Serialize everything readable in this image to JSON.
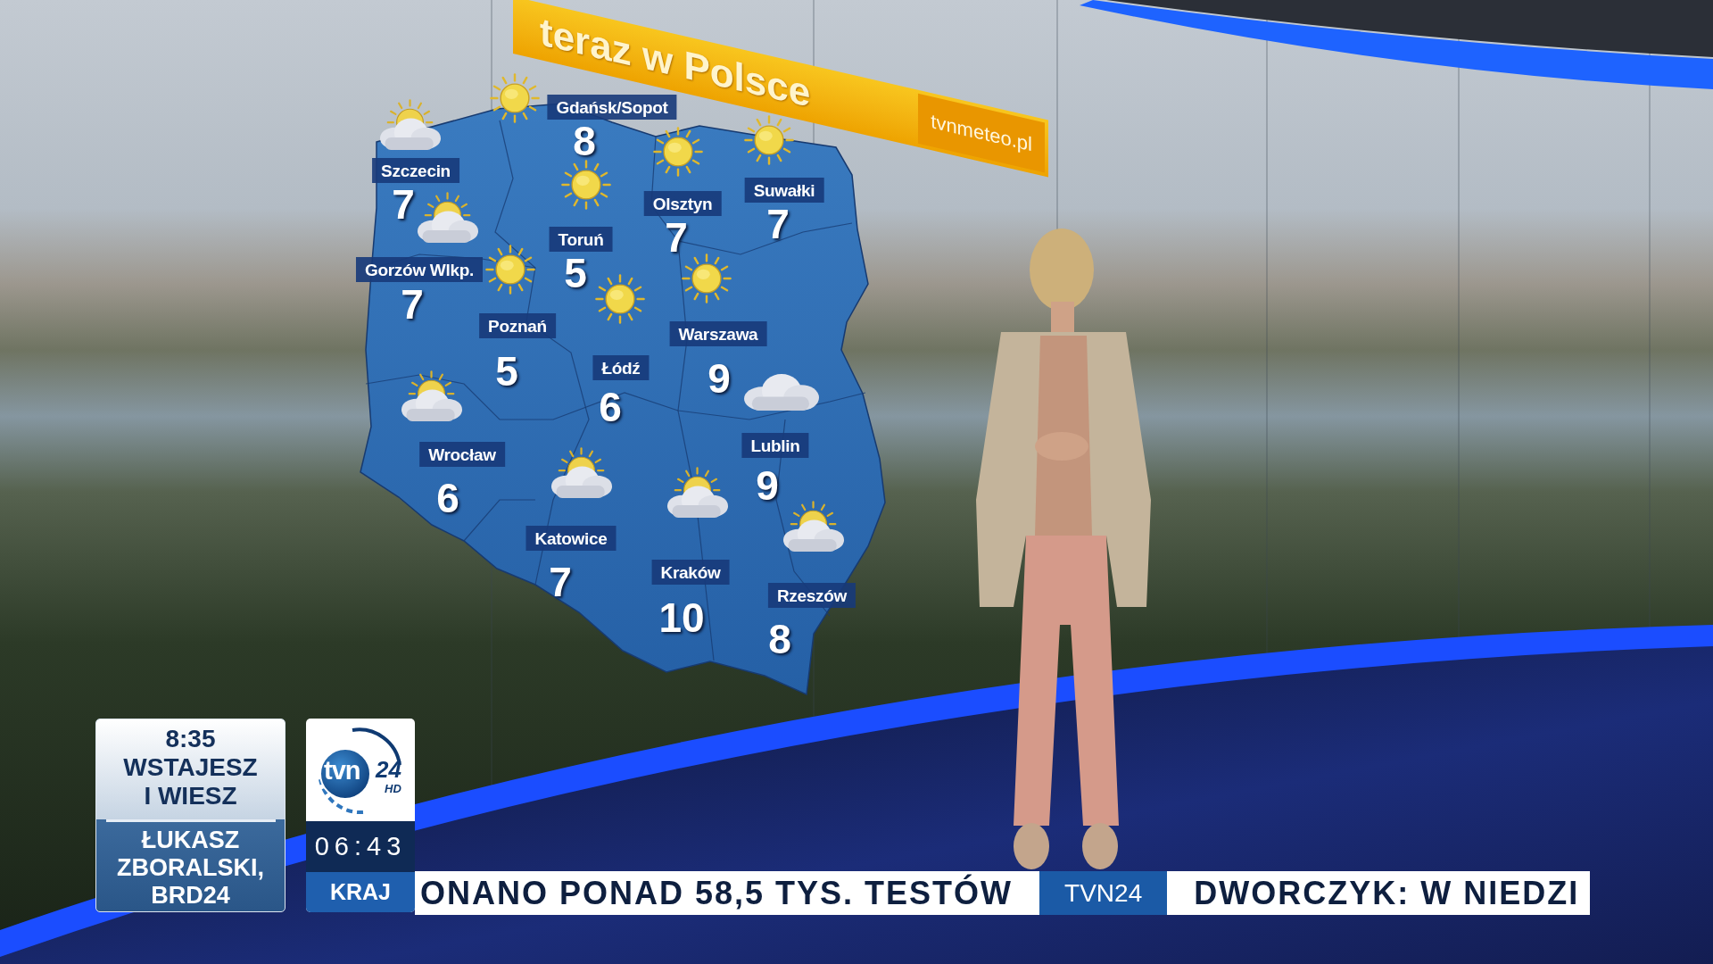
{
  "banner": {
    "title": "teraz w Polsce",
    "website": "tvnmeteo.pl"
  },
  "cities": [
    {
      "name": "Gdańsk/Sopot",
      "temp": "8",
      "kind": "sun"
    },
    {
      "name": "Szczecin",
      "temp": "7",
      "kind": "sun-cloud"
    },
    {
      "name": "Suwałki",
      "temp": "7",
      "kind": "sun"
    },
    {
      "name": "Olsztyn",
      "temp": "7",
      "kind": "sun"
    },
    {
      "name": "Toruń",
      "temp": "5",
      "kind": "sun"
    },
    {
      "name": "Gorzów Wlkp.",
      "temp": "7",
      "kind": "sun-cloud"
    },
    {
      "name": "Poznań",
      "temp": "5",
      "kind": "sun"
    },
    {
      "name": "Warszawa",
      "temp": "9",
      "kind": "sun"
    },
    {
      "name": "Łódź",
      "temp": "6",
      "kind": "sun"
    },
    {
      "name": "Lublin",
      "temp": "9",
      "kind": "cloud"
    },
    {
      "name": "Wrocław",
      "temp": "6",
      "kind": "sun-cloud"
    },
    {
      "name": "Katowice",
      "temp": "7",
      "kind": "sun-cloud"
    },
    {
      "name": "Kraków",
      "temp": "10",
      "kind": "sun-cloud"
    },
    {
      "name": "Rzeszów",
      "temp": "8",
      "kind": "sun-cloud"
    }
  ],
  "program_box": {
    "time": "8:35",
    "title": "WSTAJESZ I WIESZ",
    "guest": "ŁUKASZ ZBORALSKI, BRD24"
  },
  "channel_box": {
    "logo": {
      "name": "tvn",
      "number": "24",
      "suffix": "HD"
    },
    "clock": "06:43",
    "section": "KRAJ"
  },
  "ticker": [
    {
      "kind": "headline",
      "text": "ONANO PONAD 58,5 TYS. TESTÓW"
    },
    {
      "kind": "channel",
      "text": "TVN24"
    },
    {
      "kind": "headline",
      "text": "DWORCZYK: W NIEDZI"
    }
  ]
}
